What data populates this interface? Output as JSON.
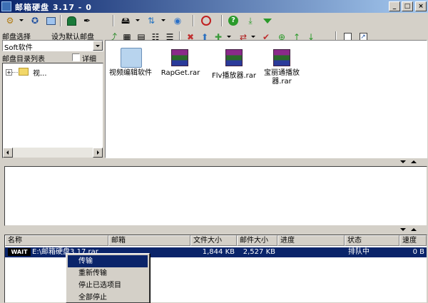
{
  "window": {
    "title": "邮箱硬盘 3.17 - 0",
    "minimize": "_",
    "maximize": "□",
    "close": "×"
  },
  "toolbar1": {
    "icons": [
      "settings-icon",
      "gear-icon",
      "screen-icon",
      "home-icon",
      "pin-icon",
      "drive-icon",
      "network-icon",
      "globe-icon",
      "power-icon",
      "help-icon",
      "download-icon",
      "chevron-down-icon"
    ]
  },
  "toolbar2": {
    "mailbox_select_label": "邮盘选择",
    "set_default_label": "设为默认邮盘"
  },
  "left": {
    "mailbox_value": "Soft软件",
    "dir_list_label": "邮盘目录列表",
    "detail_label": "详细",
    "tree": [
      {
        "label": "视..."
      }
    ]
  },
  "files": [
    {
      "name": "视频编辑软件",
      "icon": "folder-icon"
    },
    {
      "name": "RapGet.rar",
      "icon": "rar-archive-icon"
    },
    {
      "name": "Flv播放器.rar",
      "icon": "rar-archive-icon"
    },
    {
      "name": "宝丽通播放器.rar",
      "icon": "rar-archive-icon"
    }
  ],
  "transfer": {
    "columns": [
      "名称",
      "邮箱",
      "文件大小",
      "邮件大小",
      "进度",
      "状态",
      "速度"
    ],
    "rows": [
      {
        "badge": "WAIT",
        "name": "E:\\邮箱硬盘3.17.rar",
        "mailbox": "",
        "file_size": "1,844 KB",
        "mail_size": "2,527 KB",
        "progress": "",
        "status": "排队中",
        "speed": "0 B"
      }
    ]
  },
  "context_menu": {
    "items": [
      "传输",
      "重新传输",
      "停止已选项目",
      "全部停止"
    ],
    "selected_index": 0
  },
  "colors": {
    "title_bar": "#0a246a",
    "selection": "#0a246a",
    "face": "#d4d0c8"
  }
}
